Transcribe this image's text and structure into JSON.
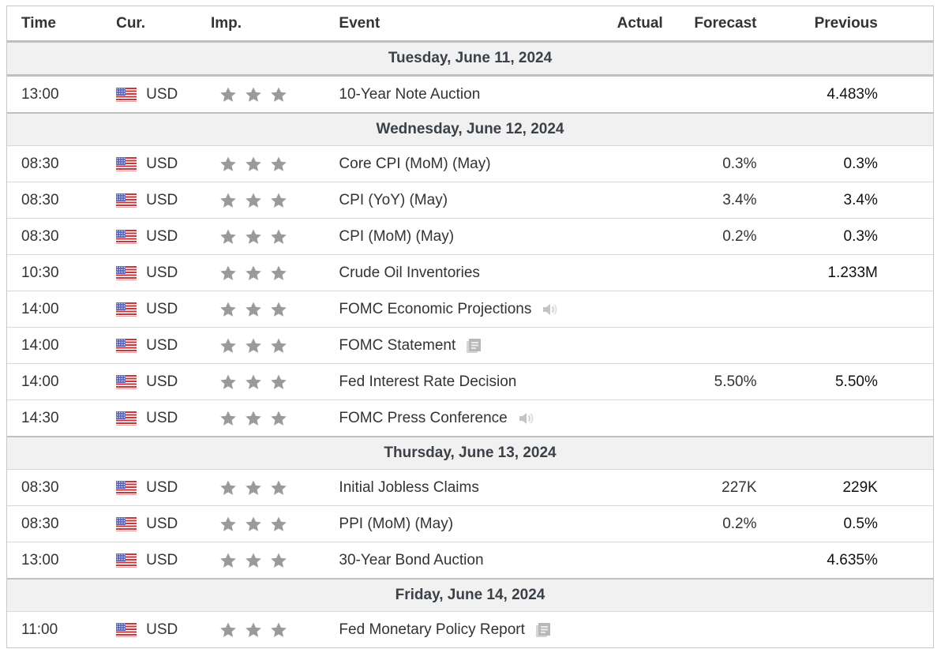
{
  "columns": {
    "time": "Time",
    "currency": "Cur.",
    "importance": "Imp.",
    "event": "Event",
    "actual": "Actual",
    "forecast": "Forecast",
    "previous": "Previous"
  },
  "colors": {
    "star": "#9a9a9a",
    "date_row_bg": "#f1f1f1",
    "date_text": "#3b4148"
  },
  "days": [
    {
      "date": "Tuesday, June 11, 2024",
      "events": [
        {
          "time": "13:00",
          "currency": "USD",
          "flag": "us-flag-icon",
          "importance": 3,
          "event": "10-Year Note Auction",
          "icon": "",
          "actual": "",
          "forecast": "",
          "previous": "4.483%"
        }
      ]
    },
    {
      "date": "Wednesday, June 12, 2024",
      "events": [
        {
          "time": "08:30",
          "currency": "USD",
          "flag": "us-flag-icon",
          "importance": 3,
          "event": "Core CPI (MoM) (May)",
          "icon": "",
          "actual": "",
          "forecast": "0.3%",
          "previous": "0.3%"
        },
        {
          "time": "08:30",
          "currency": "USD",
          "flag": "us-flag-icon",
          "importance": 3,
          "event": "CPI (YoY) (May)",
          "icon": "",
          "actual": "",
          "forecast": "3.4%",
          "previous": "3.4%"
        },
        {
          "time": "08:30",
          "currency": "USD",
          "flag": "us-flag-icon",
          "importance": 3,
          "event": "CPI (MoM) (May)",
          "icon": "",
          "actual": "",
          "forecast": "0.2%",
          "previous": "0.3%"
        },
        {
          "time": "10:30",
          "currency": "USD",
          "flag": "us-flag-icon",
          "importance": 3,
          "event": "Crude Oil Inventories",
          "icon": "",
          "actual": "",
          "forecast": "",
          "previous": "1.233M"
        },
        {
          "time": "14:00",
          "currency": "USD",
          "flag": "us-flag-icon",
          "importance": 3,
          "event": "FOMC Economic Projections",
          "icon": "speaker-icon",
          "actual": "",
          "forecast": "",
          "previous": ""
        },
        {
          "time": "14:00",
          "currency": "USD",
          "flag": "us-flag-icon",
          "importance": 3,
          "event": "FOMC Statement",
          "icon": "document-icon",
          "actual": "",
          "forecast": "",
          "previous": ""
        },
        {
          "time": "14:00",
          "currency": "USD",
          "flag": "us-flag-icon",
          "importance": 3,
          "event": "Fed Interest Rate Decision",
          "icon": "",
          "actual": "",
          "forecast": "5.50%",
          "previous": "5.50%"
        },
        {
          "time": "14:30",
          "currency": "USD",
          "flag": "us-flag-icon",
          "importance": 3,
          "event": "FOMC Press Conference",
          "icon": "speaker-icon",
          "actual": "",
          "forecast": "",
          "previous": ""
        }
      ]
    },
    {
      "date": "Thursday, June 13, 2024",
      "events": [
        {
          "time": "08:30",
          "currency": "USD",
          "flag": "us-flag-icon",
          "importance": 3,
          "event": "Initial Jobless Claims",
          "icon": "",
          "actual": "",
          "forecast": "227K",
          "previous": "229K"
        },
        {
          "time": "08:30",
          "currency": "USD",
          "flag": "us-flag-icon",
          "importance": 3,
          "event": "PPI (MoM) (May)",
          "icon": "",
          "actual": "",
          "forecast": "0.2%",
          "previous": "0.5%"
        },
        {
          "time": "13:00",
          "currency": "USD",
          "flag": "us-flag-icon",
          "importance": 3,
          "event": "30-Year Bond Auction",
          "icon": "",
          "actual": "",
          "forecast": "",
          "previous": "4.635%"
        }
      ]
    },
    {
      "date": "Friday, June 14, 2024",
      "events": [
        {
          "time": "11:00",
          "currency": "USD",
          "flag": "us-flag-icon",
          "importance": 3,
          "event": "Fed Monetary Policy Report",
          "icon": "document-icon",
          "actual": "",
          "forecast": "",
          "previous": ""
        }
      ]
    }
  ]
}
